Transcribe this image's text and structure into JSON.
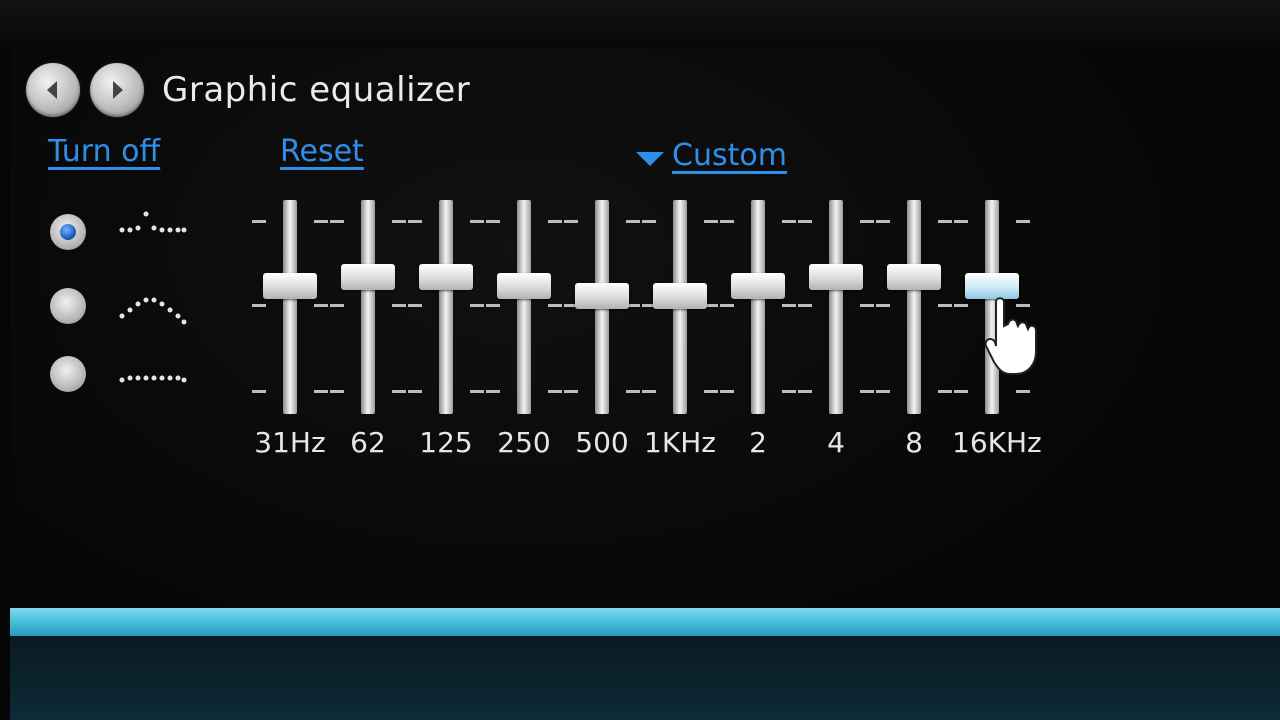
{
  "header": {
    "title": "Graphic equalizer",
    "back": "back",
    "forward": "forward"
  },
  "controls": {
    "turn_off": "Turn off",
    "reset": "Reset",
    "preset": "Custom"
  },
  "presets": [
    {
      "name": "flat-random",
      "checked": true
    },
    {
      "name": "arch",
      "checked": false
    },
    {
      "name": "flat",
      "checked": false
    }
  ],
  "bands": [
    {
      "label": "31Hz",
      "level": 0.4
    },
    {
      "label": "62",
      "level": 0.36
    },
    {
      "label": "125",
      "level": 0.36
    },
    {
      "label": "250",
      "level": 0.4
    },
    {
      "label": "500",
      "level": 0.45
    },
    {
      "label": "1KHz",
      "level": 0.45
    },
    {
      "label": "2",
      "level": 0.4
    },
    {
      "label": "4",
      "level": 0.36
    },
    {
      "label": "8",
      "level": 0.36
    },
    {
      "label": "16KHz",
      "level": 0.4
    }
  ],
  "colors": {
    "link": "#2f8fe8",
    "progress": "#3cb8d6",
    "radio_selected": "#1f5fbf"
  }
}
